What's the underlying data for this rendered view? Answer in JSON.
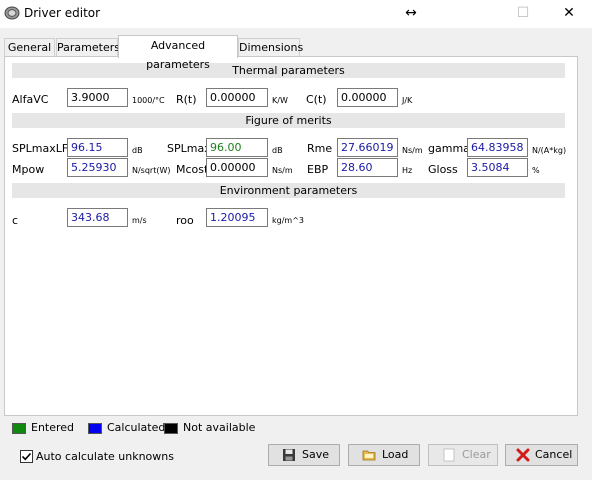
{
  "window": {
    "title": "Driver editor",
    "restore_glyph": "↔",
    "maximize_glyph": "☐",
    "close_glyph": "✕"
  },
  "tabs": [
    {
      "label": "General"
    },
    {
      "label": "Parameters"
    },
    {
      "label": "Advanced parameters",
      "active": true
    },
    {
      "label": "Dimensions"
    }
  ],
  "sections": {
    "thermal": "Thermal parameters",
    "merits": "Figure of merits",
    "environment": "Environment parameters"
  },
  "thermal": {
    "alfavc": {
      "label": "AlfaVC",
      "value": "3.9000",
      "unit": "1000/°C"
    },
    "rt": {
      "label": "R(t)",
      "value": "0.00000",
      "unit": "K/W"
    },
    "ct": {
      "label": "C(t)",
      "value": "0.00000",
      "unit": "J/K"
    }
  },
  "merits": {
    "splmaxlf": {
      "label": "SPLmaxLF",
      "value": "96.15",
      "unit": "dB"
    },
    "splmax": {
      "label": "SPLmax",
      "value": "96.00",
      "unit": "dB"
    },
    "rme": {
      "label": "Rme",
      "value": "27.66019",
      "unit": "Ns/m"
    },
    "gamma": {
      "label": "gamma",
      "value": "64.83958",
      "unit": "N/(A*kg)"
    },
    "mpow": {
      "label": "Mpow",
      "value": "5.25930",
      "unit": "N/sqrt(W)"
    },
    "mcost": {
      "label": "Mcost",
      "value": "0.00000",
      "unit": "Ns/m"
    },
    "ebp": {
      "label": "EBP",
      "value": "28.60",
      "unit": "Hz"
    },
    "gloss": {
      "label": "Gloss",
      "value": "3.5084",
      "unit": "%"
    }
  },
  "environment": {
    "c": {
      "label": "c",
      "value": "343.68",
      "unit": "m/s"
    },
    "roo": {
      "label": "roo",
      "value": "1.20095",
      "unit": "kg/m^3"
    }
  },
  "legend": {
    "entered": {
      "label": "Entered",
      "color": "#0f8a0f"
    },
    "calculated": {
      "label": "Calculated",
      "color": "#0000ee"
    },
    "na": {
      "label": "Not available",
      "color": "#000000"
    }
  },
  "auto_calc": {
    "label": "Auto calculate unknowns",
    "checked": true
  },
  "buttons": {
    "save": "Save",
    "load": "Load",
    "clear": "Clear",
    "cancel": "Cancel"
  },
  "colors": {
    "value_calculated": "#1a1aa6",
    "value_entered": "#1e7e1e",
    "section_band": "#e6e6e6"
  }
}
